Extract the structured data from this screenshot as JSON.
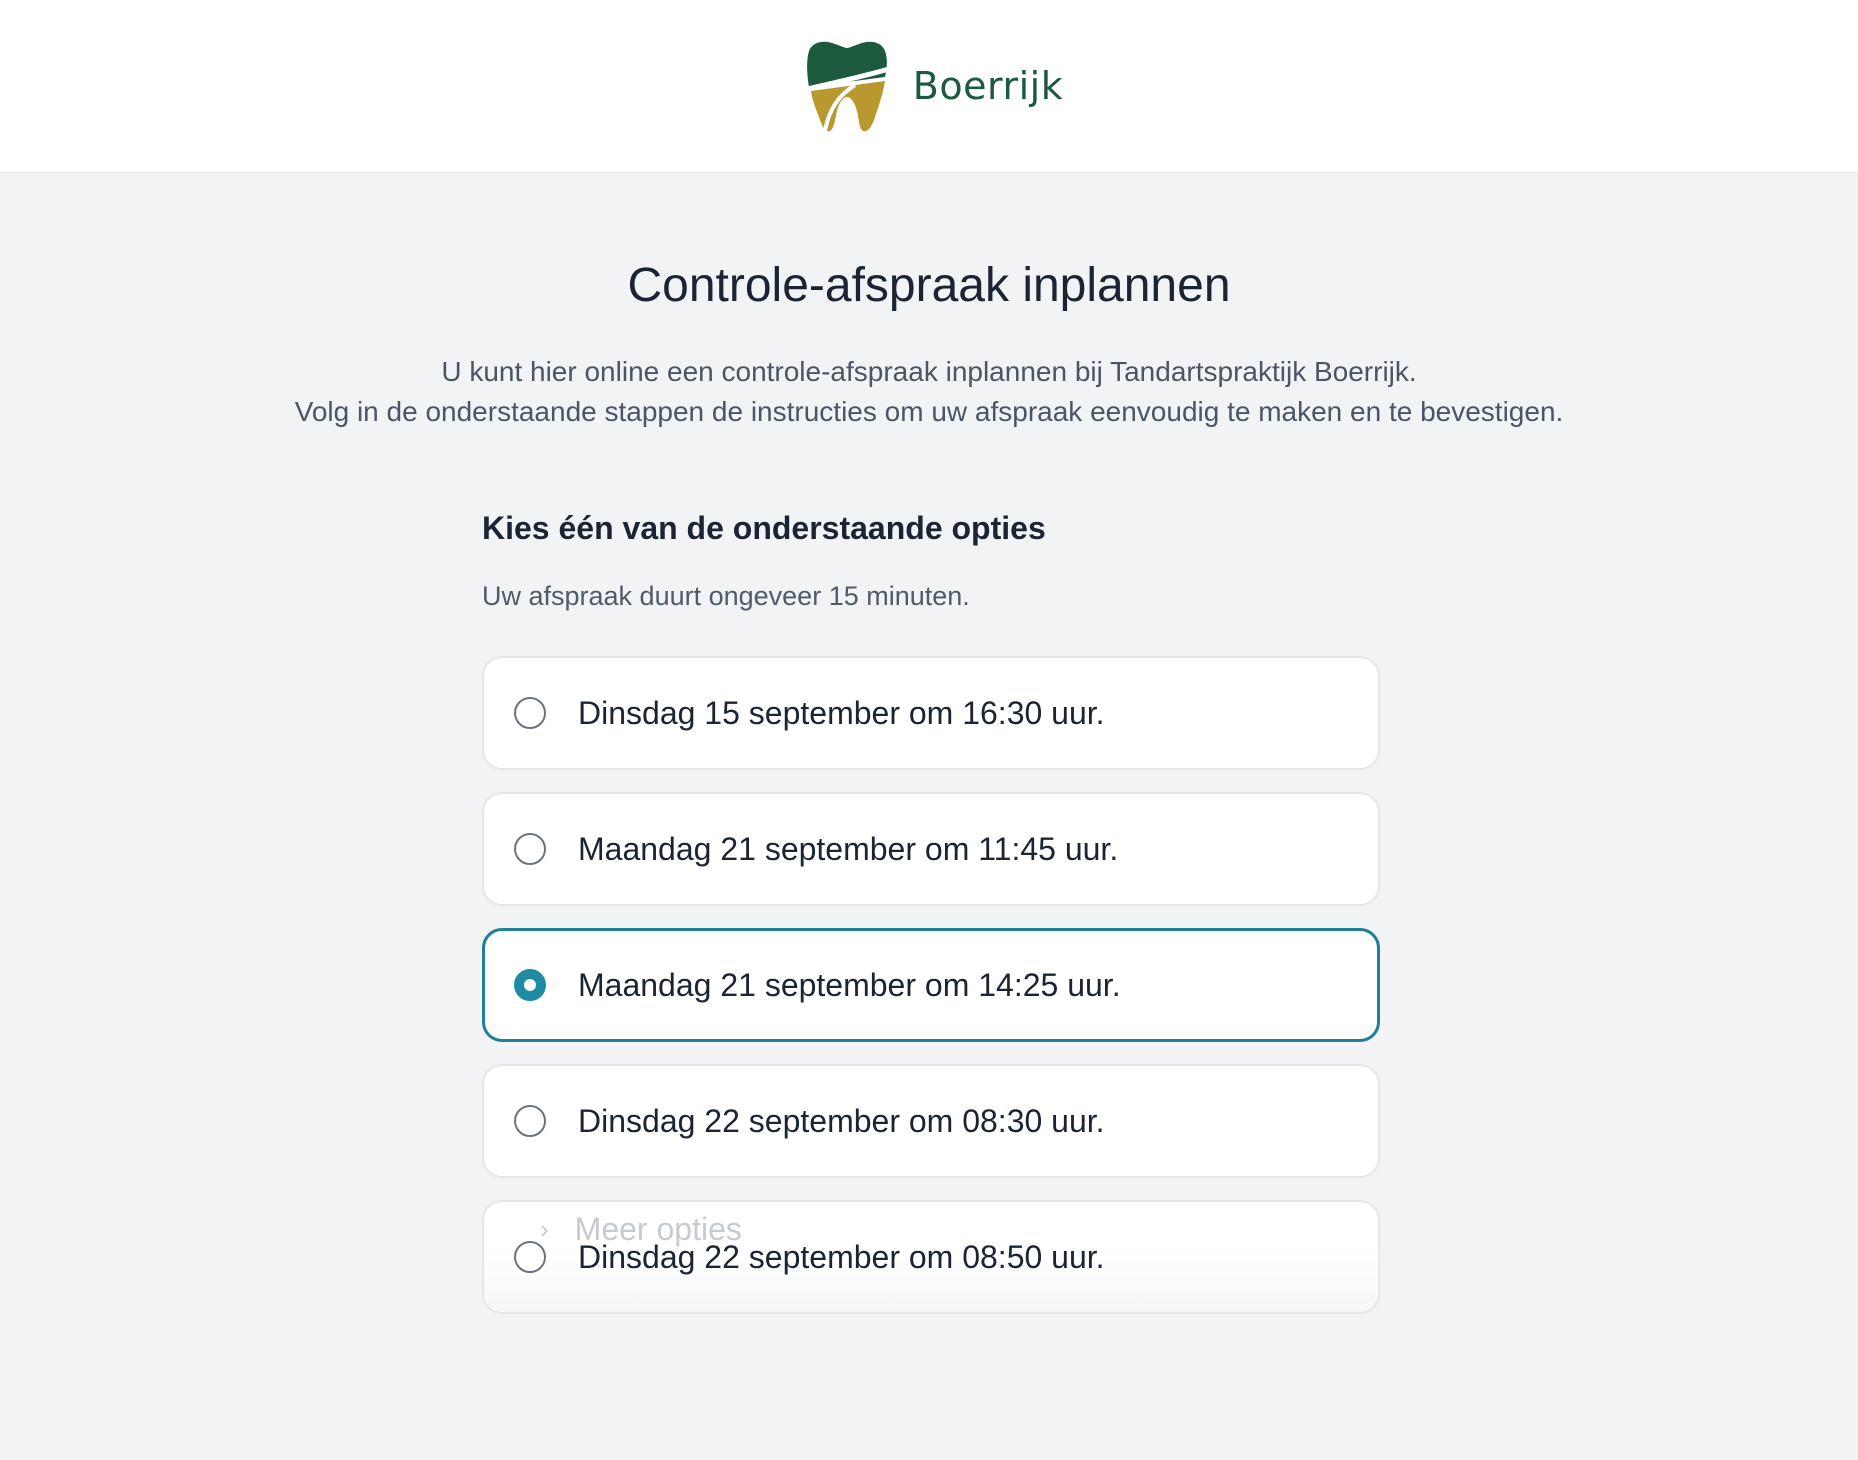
{
  "header": {
    "brand_name": "Boerrijk",
    "logo_colors": {
      "crown": "#1b5a3c",
      "root": "#b8982f"
    }
  },
  "page": {
    "title": "Controle-afspraak inplannen",
    "intro_line1": "U kunt hier online een controle-afspraak inplannen bij Tandartspraktijk Boerrijk.",
    "intro_line2": "Volg in de onderstaande stappen de instructies om uw afspraak eenvoudig te maken en te bevestigen."
  },
  "section": {
    "title": "Kies één van de onderstaande opties",
    "duration": "Uw afspraak duurt ongeveer 15 minuten."
  },
  "options": [
    {
      "label": "Dinsdag 15 september om 16:30 uur.",
      "selected": false
    },
    {
      "label": "Maandag 21 september om 11:45 uur.",
      "selected": false
    },
    {
      "label": "Maandag 21 september om 14:25 uur.",
      "selected": true
    },
    {
      "label": "Dinsdag 22 september om 08:30 uur.",
      "selected": false
    },
    {
      "label": "Dinsdag 22 september om 08:50 uur.",
      "selected": false
    }
  ],
  "more": {
    "label": "Meer opties",
    "icon": "chevron-right-icon"
  },
  "colors": {
    "accent": "#1f8ba3",
    "background": "#f2f3f5"
  }
}
